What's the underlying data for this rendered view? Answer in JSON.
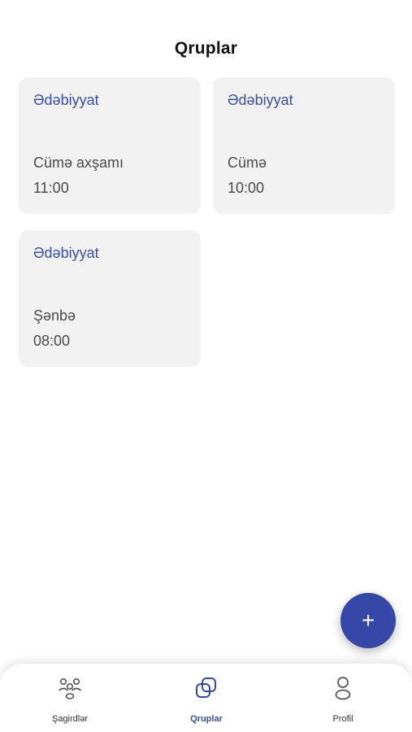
{
  "header": {
    "title": "Qruplar"
  },
  "groups": [
    {
      "subject": "Ədəbiyyat",
      "day": "Cümə axşamı",
      "time": "11:00"
    },
    {
      "subject": "Ədəbiyyat",
      "day": "Cümə",
      "time": "10:00"
    },
    {
      "subject": "Ədəbiyyat",
      "day": "Şənbə",
      "time": "08:00"
    }
  ],
  "fab": {
    "icon": "plus-icon",
    "label": "+"
  },
  "bottom_nav": {
    "items": [
      {
        "label": "Şagirdlər",
        "icon": "students-icon",
        "active": false
      },
      {
        "label": "Qruplar",
        "icon": "groups-icon",
        "active": true
      },
      {
        "label": "Profil",
        "icon": "profile-icon",
        "active": false
      }
    ]
  },
  "colors": {
    "accent": "#3548a8",
    "accent_text": "#3a4fa8",
    "card_bg": "#f2f2f2",
    "inactive_icon": "#555555"
  }
}
